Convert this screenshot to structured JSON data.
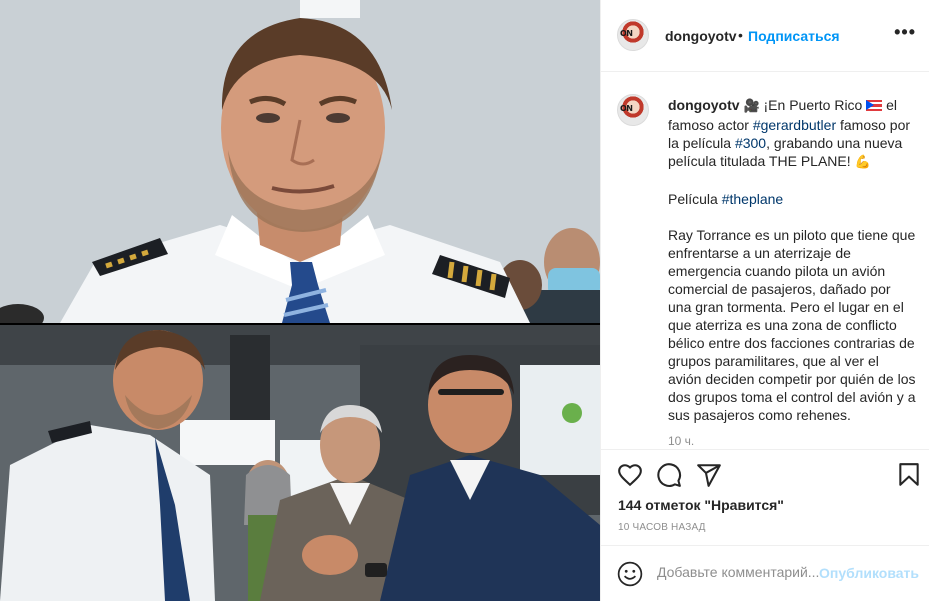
{
  "post": {
    "username": "dongoyotv",
    "avatar_text": "ON",
    "follow_label": "Подписаться",
    "more_label": "•••"
  },
  "caption": {
    "author": "dongoyotv",
    "line1": "¡En Puerto Rico",
    "line1b": "el famoso actor",
    "tag_gerard": "#gerardbutler",
    "line1c": "famoso por la película",
    "tag_300": "#300",
    "line1d": ", grabando una nueva película titulada THE PLANE!",
    "para2_prefix": "Película",
    "tag_theplane": "#theplane",
    "para3": "Ray Torrance es un piloto que tiene que enfrentarse a un aterrizaje de emergencia cuando pilota un avión comercial de pasajeros, dañado por una gran tormenta. Pero el lugar en el que aterriza es una zona de conflicto bélico entre dos facciones contrarias de grupos paramilitares, que al ver el avión deciden competir por quién de los dos grupos toma el control del avión y a sus pasajeros como rehenes.",
    "time": "10 ч.",
    "emoji_camera": "🎥",
    "emoji_muscle": "💪"
  },
  "stats": {
    "likes": "144 отметок \"Нравится\"",
    "date": "10 ЧАСОВ НАЗАД"
  },
  "comment_box": {
    "placeholder": "Добавьте комментарий...",
    "publish_label": "Опубликовать"
  },
  "colors": {
    "link": "#0095f6",
    "hashtag": "#00376b",
    "muted": "#8e8e8e",
    "publish_disabled": "#b2dffc"
  },
  "icons": [
    "heart-icon",
    "comment-icon",
    "share-icon",
    "bookmark-icon",
    "smile-icon",
    "more-icon"
  ]
}
